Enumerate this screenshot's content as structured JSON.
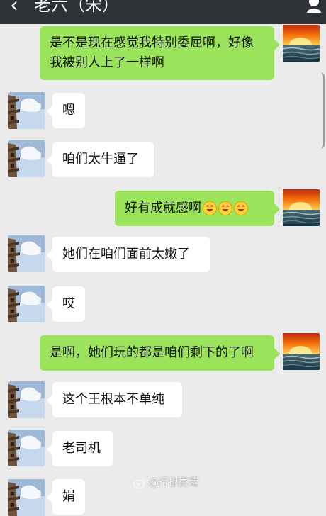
{
  "window": {
    "title": "老六（宋）",
    "back_icon": "back-icon",
    "profile_icon": "person-icon"
  },
  "avatars": {
    "left": "tower-under-sky-avatar",
    "right": "sunset-over-sea-avatar"
  },
  "messages": [
    {
      "side": "right",
      "text": "是不是现在感觉我特别委屈啊，好像我被别人上了一样啊"
    },
    {
      "side": "left",
      "text": "嗯"
    },
    {
      "side": "left",
      "text": "咱们太牛逼了"
    },
    {
      "side": "right",
      "text": "好有成就感啊",
      "emoji_count": 3
    },
    {
      "side": "left",
      "text": "她们在咱们面前太嫩了"
    },
    {
      "side": "left",
      "text": "哎"
    },
    {
      "side": "right",
      "text": "是啊，她们玩的都是咱们剩下的了啊"
    },
    {
      "side": "left",
      "text": "这个王根本不单纯"
    },
    {
      "side": "left",
      "text": "老司机"
    },
    {
      "side": "left",
      "text": "娟"
    }
  ],
  "watermark": {
    "text": "@行摄香港",
    "icon": "weibo-icon"
  }
}
